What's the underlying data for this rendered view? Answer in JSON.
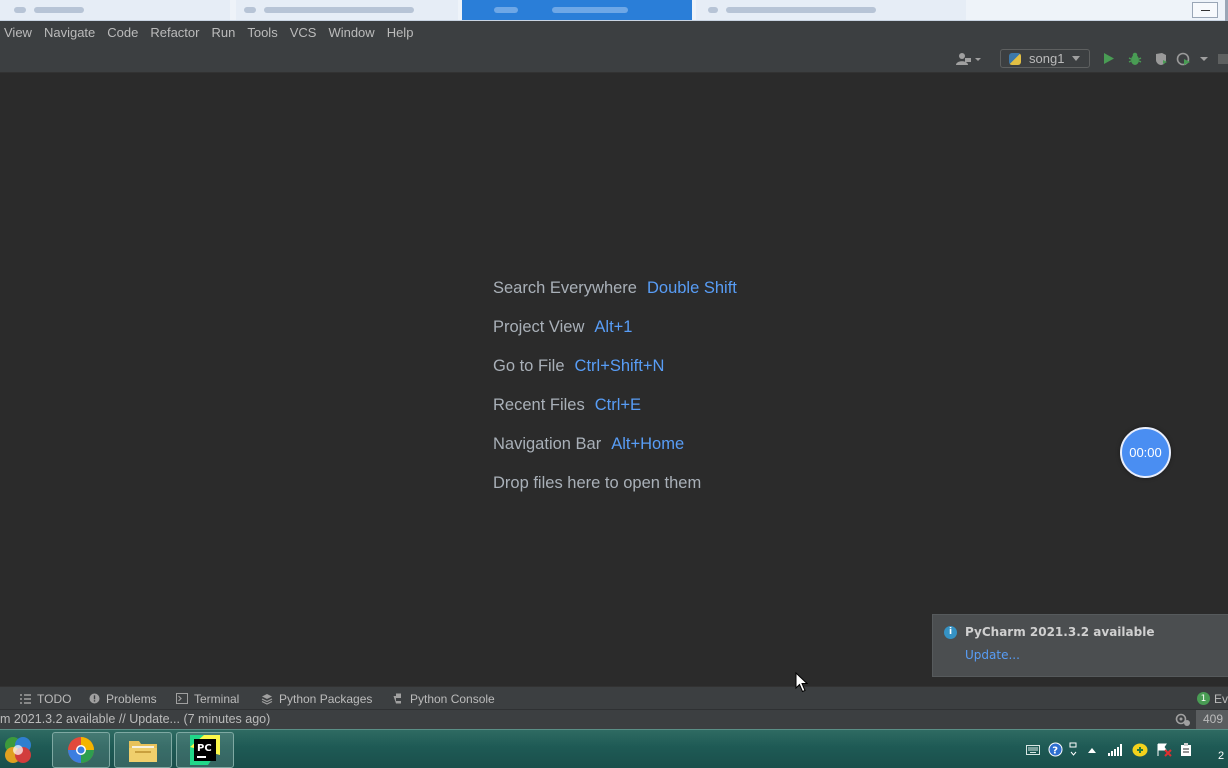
{
  "menu": {
    "items": [
      "View",
      "Navigate",
      "Code",
      "Refactor",
      "Run",
      "Tools",
      "VCS",
      "Window",
      "Help"
    ]
  },
  "toolbar": {
    "run_config": "song1"
  },
  "welcome": {
    "hints": [
      {
        "action": "Search Everywhere",
        "shortcut": "Double Shift"
      },
      {
        "action": "Project View",
        "shortcut": "Alt+1"
      },
      {
        "action": "Go to File",
        "shortcut": "Ctrl+Shift+N"
      },
      {
        "action": "Recent Files",
        "shortcut": "Ctrl+E"
      },
      {
        "action": "Navigation Bar",
        "shortcut": "Alt+Home"
      },
      {
        "action": "Drop files here to open them",
        "shortcut": ""
      }
    ]
  },
  "timer": "00:00",
  "notification": {
    "title": "PyCharm 2021.3.2 available",
    "link": "Update..."
  },
  "tool_windows": {
    "todo": "TODO",
    "problems": "Problems",
    "terminal": "Terminal",
    "python_packages": "Python Packages",
    "python_console": "Python Console",
    "event_log_count": "1",
    "event_log": "Ev"
  },
  "status": {
    "message": "m 2021.3.2 available // Update... (7 minutes ago)",
    "memory": "409"
  },
  "taskbar": {
    "pycharm_label": "PC",
    "clock_fragment": "2"
  },
  "colors": {
    "background": "#2b2b2b",
    "chrome": "#3c3f41",
    "shortcut": "#589df6",
    "hint_text": "#a9b0b8",
    "timer": "#4a8ef2"
  }
}
